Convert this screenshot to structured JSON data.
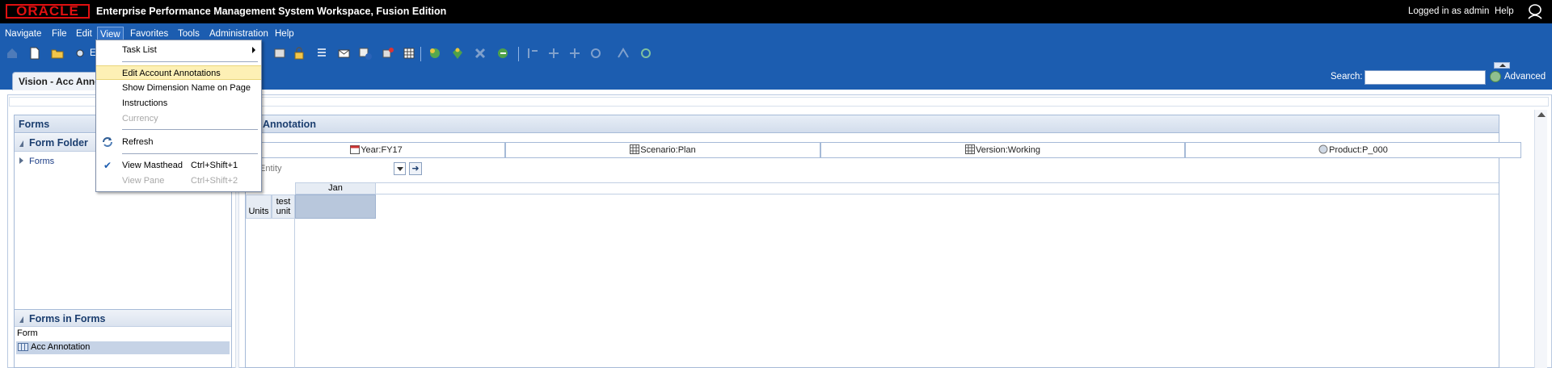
{
  "masthead": {
    "logo_text": "ORACLE",
    "app_title": "Enterprise Performance Management System Workspace, Fusion Edition",
    "logged_in": "Logged in as admin",
    "help": "Help"
  },
  "menubar": {
    "items": [
      "Navigate",
      "File",
      "Edit",
      "View",
      "Favorites",
      "Tools",
      "Administration",
      "Help"
    ],
    "active": "View"
  },
  "tab": {
    "label": "Vision - Acc Anno"
  },
  "toolbar": {
    "partial_label": "E"
  },
  "search": {
    "label": "Search:",
    "value": "",
    "advanced": "Advanced"
  },
  "view_menu": {
    "items": [
      {
        "label": "Task List",
        "submenu": true,
        "enabled": true
      },
      {
        "label": "Edit Account Annotations",
        "enabled": true,
        "highlighted": true
      },
      {
        "label": "Show Dimension Name on Page",
        "enabled": true
      },
      {
        "label": "Instructions",
        "enabled": true
      },
      {
        "label": "Currency",
        "enabled": false
      },
      {
        "label": "Refresh",
        "enabled": true,
        "icon": "refresh-icon"
      },
      {
        "label": "View Masthead",
        "shortcut": "Ctrl+Shift+1",
        "enabled": true,
        "checked": true
      },
      {
        "label": "View Pane",
        "shortcut": "Ctrl+Shift+2",
        "enabled": false
      }
    ]
  },
  "left_panel": {
    "title": "Forms",
    "folder_title": "Form Folder",
    "tree": [
      {
        "label": "Forms"
      }
    ],
    "forms_in_forms_title": "Forms in Forms",
    "column_header": "Form",
    "rows": [
      {
        "label": "Acc Annotation"
      }
    ]
  },
  "right_panel": {
    "title": "Annotation",
    "pov": [
      {
        "label": "Year:FY17",
        "icon": "calendar-icon"
      },
      {
        "label": "Scenario:Plan",
        "icon": "grid-icon"
      },
      {
        "label": "Version:Working",
        "icon": "grid-icon"
      },
      {
        "label": "Product:P_000",
        "icon": "globe-icon"
      }
    ],
    "page": {
      "label": "Entity"
    },
    "grid": {
      "column_headers": [
        "Jan"
      ],
      "row_headers": [
        [
          "Units",
          "test unit"
        ]
      ],
      "cells": [
        [
          ""
        ]
      ]
    }
  },
  "colors": {
    "masthead_bg": "#000000",
    "header_blue": "#1c5db0",
    "highlight": "#fdf0b5",
    "selected_row": "#c6d3e6"
  }
}
